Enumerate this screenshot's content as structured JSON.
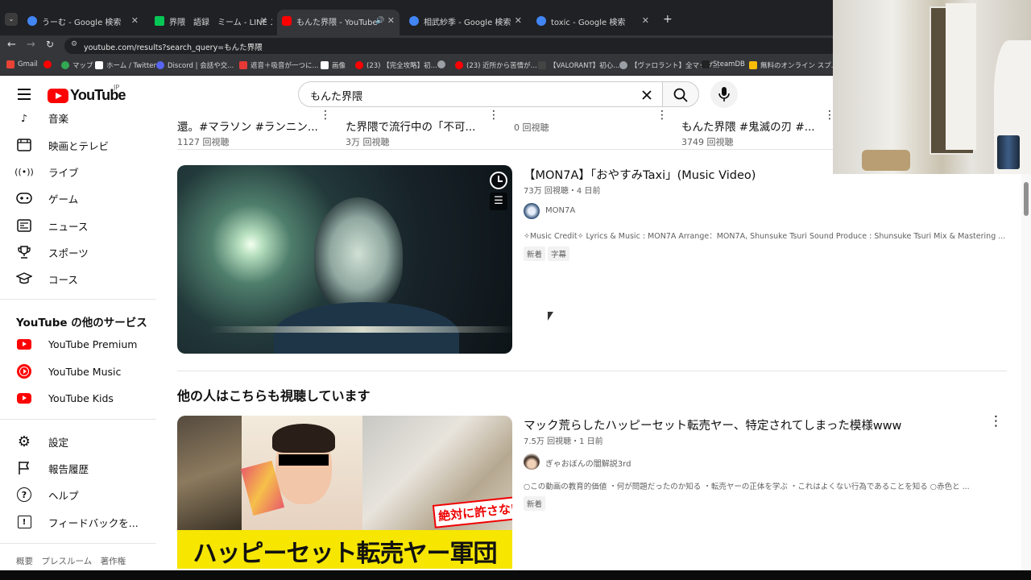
{
  "browser": {
    "tabs": [
      {
        "label": "うーむ - Google 検索",
        "color": "#4285f4"
      },
      {
        "label": "界隈　語録　ミーム - LINE スタン",
        "color": "#06c755"
      },
      {
        "label": "もんた界隈 - YouTube",
        "color": "#ff0000"
      },
      {
        "label": "相武紗季 - Google 検索",
        "color": "#4285f4"
      },
      {
        "label": "toxic - Google 検索",
        "color": "#4285f4"
      }
    ],
    "new_tab": "+",
    "url": "youtube.com/results?search_query=もんた界隈",
    "bookmarks": [
      {
        "label": "Gmail",
        "color": "#ea4335"
      },
      {
        "label": "",
        "color": "#ff0000"
      },
      {
        "label": "マップ",
        "color": "#34a853"
      },
      {
        "label": "ホーム / Twitter",
        "color": "#ffffff"
      },
      {
        "label": "Discord | 会話や交...",
        "color": "#5865f2"
      },
      {
        "label": "遮音＋吸音が一つに...",
        "color": "#e53935"
      },
      {
        "label": "画像",
        "color": "#ffffff"
      },
      {
        "label": "(23) 【完全攻略】初...",
        "color": "#ff0000"
      },
      {
        "label": "",
        "color": "#9aa0a6"
      },
      {
        "label": "(23) 近所から苦情が...",
        "color": "#ff0000"
      },
      {
        "label": "【VALORANT】初心...",
        "color": "#444444"
      },
      {
        "label": "【ヴァロラント】全マップ...",
        "color": "#9aa0a6"
      },
      {
        "label": "SteamDB",
        "color": "#222222"
      },
      {
        "label": "無料のオンライン スプ...",
        "color": "#fbbc04"
      }
    ]
  },
  "youtube": {
    "logo_text": "YouTube",
    "region": "JP",
    "search_value": "もんた界隈",
    "clear_icon": "close-icon",
    "search_icon": "search-icon",
    "mic_icon": "mic-icon"
  },
  "sidebar": {
    "items": [
      {
        "label": "音楽",
        "icon": "music-note-icon"
      },
      {
        "label": "映画とテレビ",
        "icon": "film-icon"
      },
      {
        "label": "ライブ",
        "icon": "live-icon"
      },
      {
        "label": "ゲーム",
        "icon": "gamepad-icon"
      },
      {
        "label": "ニュース",
        "icon": "news-icon"
      },
      {
        "label": "スポーツ",
        "icon": "trophy-icon"
      },
      {
        "label": "コース",
        "icon": "graduation-cap-icon"
      }
    ],
    "services_title": "YouTube の他のサービス",
    "services": [
      {
        "label": "YouTube Premium",
        "icon": "youtube-premium-icon"
      },
      {
        "label": "YouTube Music",
        "icon": "youtube-music-icon"
      },
      {
        "label": "YouTube Kids",
        "icon": "youtube-kids-icon"
      }
    ],
    "settings": [
      {
        "label": "設定",
        "icon": "gear-icon"
      },
      {
        "label": "報告履歴",
        "icon": "flag-icon"
      },
      {
        "label": "ヘルプ",
        "icon": "help-icon"
      },
      {
        "label": "フィードバックを...",
        "icon": "feedback-icon"
      }
    ],
    "footer": "概要　プレスルーム　著作権"
  },
  "shorts_row": [
    {
      "title": "還。#マラソン #ランニン...",
      "views": "1127 回視聴"
    },
    {
      "title": "た界隈で流行中の「不可...",
      "views": "3万 回視聴"
    },
    {
      "title": "",
      "views": "0 回視聴"
    },
    {
      "title": "もんた界隈 #鬼滅の刃 #...",
      "views": "3749 回視聴"
    }
  ],
  "video1": {
    "title": "【MON7A】「おやすみTaxi」(Music Video)",
    "meta": "73万 回視聴・4 日前",
    "channel": "MON7A",
    "description": "✧Music Credit✧ Lyrics & Music : MON7A Arrange：MON7A, Shunsuke Tsuri Sound Produce : Shunsuke Tsuri Mix & Mastering ...",
    "badges": [
      "新着",
      "字幕"
    ]
  },
  "section_title": "他の人はこちらも視聴しています",
  "video2": {
    "title": "マック荒らしたハッピーセット転売ヤー、特定されてしまった模様www",
    "meta": "7.5万 回視聴・1 日前",
    "channel": "ぎゃおぼんの闇解説3rd",
    "description": "○この動画の教育的価値 ・何が問題だったのか知る ・転売ヤーの正体を学ぶ ・これはよくない行為であることを知る ○赤色と ...",
    "badges": [
      "新着"
    ],
    "thumb_caption": "ハッピーセット転売ヤー軍団",
    "thumb_stamp": "絶対に許さない！"
  }
}
